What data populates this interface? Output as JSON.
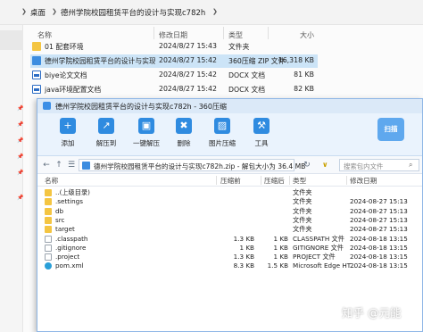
{
  "explorer": {
    "breadcrumb": [
      "桌面",
      "德州学院校园租赁平台的设计与实现c782h"
    ],
    "columns": [
      "名称",
      "修改日期",
      "类型",
      "大小"
    ],
    "files": [
      {
        "name": "01 配套环境",
        "date": "2024/8/27 15:43",
        "type": "文件夹",
        "size": "",
        "icon": "folder",
        "selected": false
      },
      {
        "name": "德州学院校园租赁平台的设计与实现c782h.zip",
        "date": "2024/8/27 15:42",
        "type": "360压缩 ZIP 文件",
        "size": "16,318 KB",
        "icon": "zip",
        "selected": true
      },
      {
        "name": "biye论文文档",
        "date": "2024/8/27 15:42",
        "type": "DOCX 文档",
        "size": "81 KB",
        "icon": "doc",
        "selected": false
      },
      {
        "name": "java环境配置文档",
        "date": "2024/8/27 15:42",
        "type": "DOCX 文档",
        "size": "82 KB",
        "icon": "doc",
        "selected": false
      }
    ]
  },
  "zipwin": {
    "title": "德州学院校园租赁平台的设计与实现c782h - 360压缩",
    "toolbar": [
      {
        "label": "添加",
        "icon": "add-icon"
      },
      {
        "label": "解压到",
        "icon": "extract-icon"
      },
      {
        "label": "一键解压",
        "icon": "one-click-extract-icon"
      },
      {
        "label": "删除",
        "icon": "delete-icon"
      },
      {
        "label": "图片压缩",
        "icon": "image-compress-icon"
      },
      {
        "label": "工具",
        "icon": "tools-icon"
      }
    ],
    "brand": "扫描",
    "address": "德州学院校园租赁平台的设计与实现c782h.zip - 解包大小为 36.4 MB",
    "search_placeholder": "搜索包内文件",
    "columns": [
      "名称",
      "压缩前",
      "压缩后",
      "类型",
      "修改日期"
    ],
    "rows": [
      {
        "name": "..(上级目录)",
        "before": "",
        "after": "",
        "type": "文件夹",
        "date": "",
        "icon": "up"
      },
      {
        "name": ".settings",
        "before": "",
        "after": "",
        "type": "文件夹",
        "date": "2024-08-27 15:13",
        "icon": "folder"
      },
      {
        "name": "db",
        "before": "",
        "after": "",
        "type": "文件夹",
        "date": "2024-08-27 15:13",
        "icon": "folder"
      },
      {
        "name": "src",
        "before": "",
        "after": "",
        "type": "文件夹",
        "date": "2024-08-27 15:13",
        "icon": "folder"
      },
      {
        "name": "target",
        "before": "",
        "after": "",
        "type": "文件夹",
        "date": "2024-08-27 15:13",
        "icon": "folder"
      },
      {
        "name": ".classpath",
        "before": "1.3 KB",
        "after": "1 KB",
        "type": "CLASSPATH 文件",
        "date": "2024-08-18 13:15",
        "icon": "file"
      },
      {
        "name": ".gitignore",
        "before": "1 KB",
        "after": "1 KB",
        "type": "GITIGNORE 文件",
        "date": "2024-08-18 13:15",
        "icon": "file"
      },
      {
        "name": ".project",
        "before": "1.3 KB",
        "after": "1 KB",
        "type": "PROJECT 文件",
        "date": "2024-08-18 13:15",
        "icon": "file"
      },
      {
        "name": "pom.xml",
        "before": "8.3 KB",
        "after": "1.5 KB",
        "type": "Microsoft Edge HT...",
        "date": "2024-08-18 13:15",
        "icon": "edge"
      }
    ]
  },
  "watermark": "知乎 @元能"
}
